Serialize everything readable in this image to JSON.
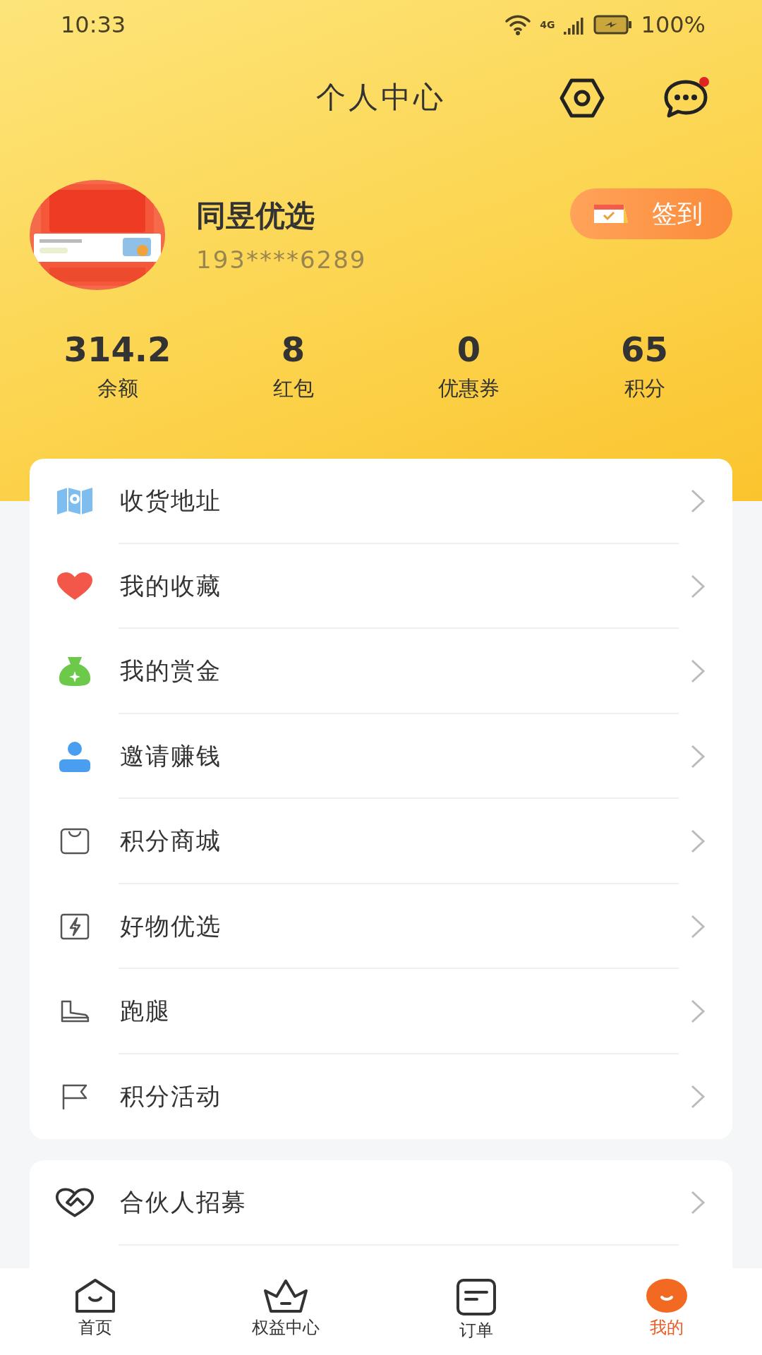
{
  "status_bar": {
    "time": "10:33",
    "network": "4G",
    "battery": "100%"
  },
  "header": {
    "title": "个人中心",
    "messages_unread": true
  },
  "profile": {
    "name": "同昱优选",
    "phone": "193****6289",
    "checkin_label": "签到"
  },
  "stats": [
    {
      "value": "314.2",
      "label": "余额"
    },
    {
      "value": "8",
      "label": "红包"
    },
    {
      "value": "0",
      "label": "优惠券"
    },
    {
      "value": "65",
      "label": "积分"
    }
  ],
  "menu": [
    {
      "kind": "map",
      "label": "收货地址"
    },
    {
      "kind": "heart",
      "label": "我的收藏"
    },
    {
      "kind": "moneybag",
      "label": "我的赏金"
    },
    {
      "kind": "person",
      "label": "邀请赚钱"
    },
    {
      "kind": "bag",
      "label": "积分商城"
    },
    {
      "kind": "bolt",
      "label": "好物优选"
    },
    {
      "kind": "boot",
      "label": "跑腿"
    },
    {
      "kind": "flag",
      "label": "积分活动"
    }
  ],
  "menu_2": [
    {
      "kind": "handshake",
      "label": "合伙人招募"
    }
  ],
  "nav": [
    {
      "kind": "home",
      "label": "首页",
      "selected": false
    },
    {
      "kind": "crown",
      "label": "权益中心",
      "selected": false
    },
    {
      "kind": "order",
      "label": "订单",
      "selected": false
    },
    {
      "kind": "me",
      "label": "我的",
      "selected": true
    }
  ]
}
